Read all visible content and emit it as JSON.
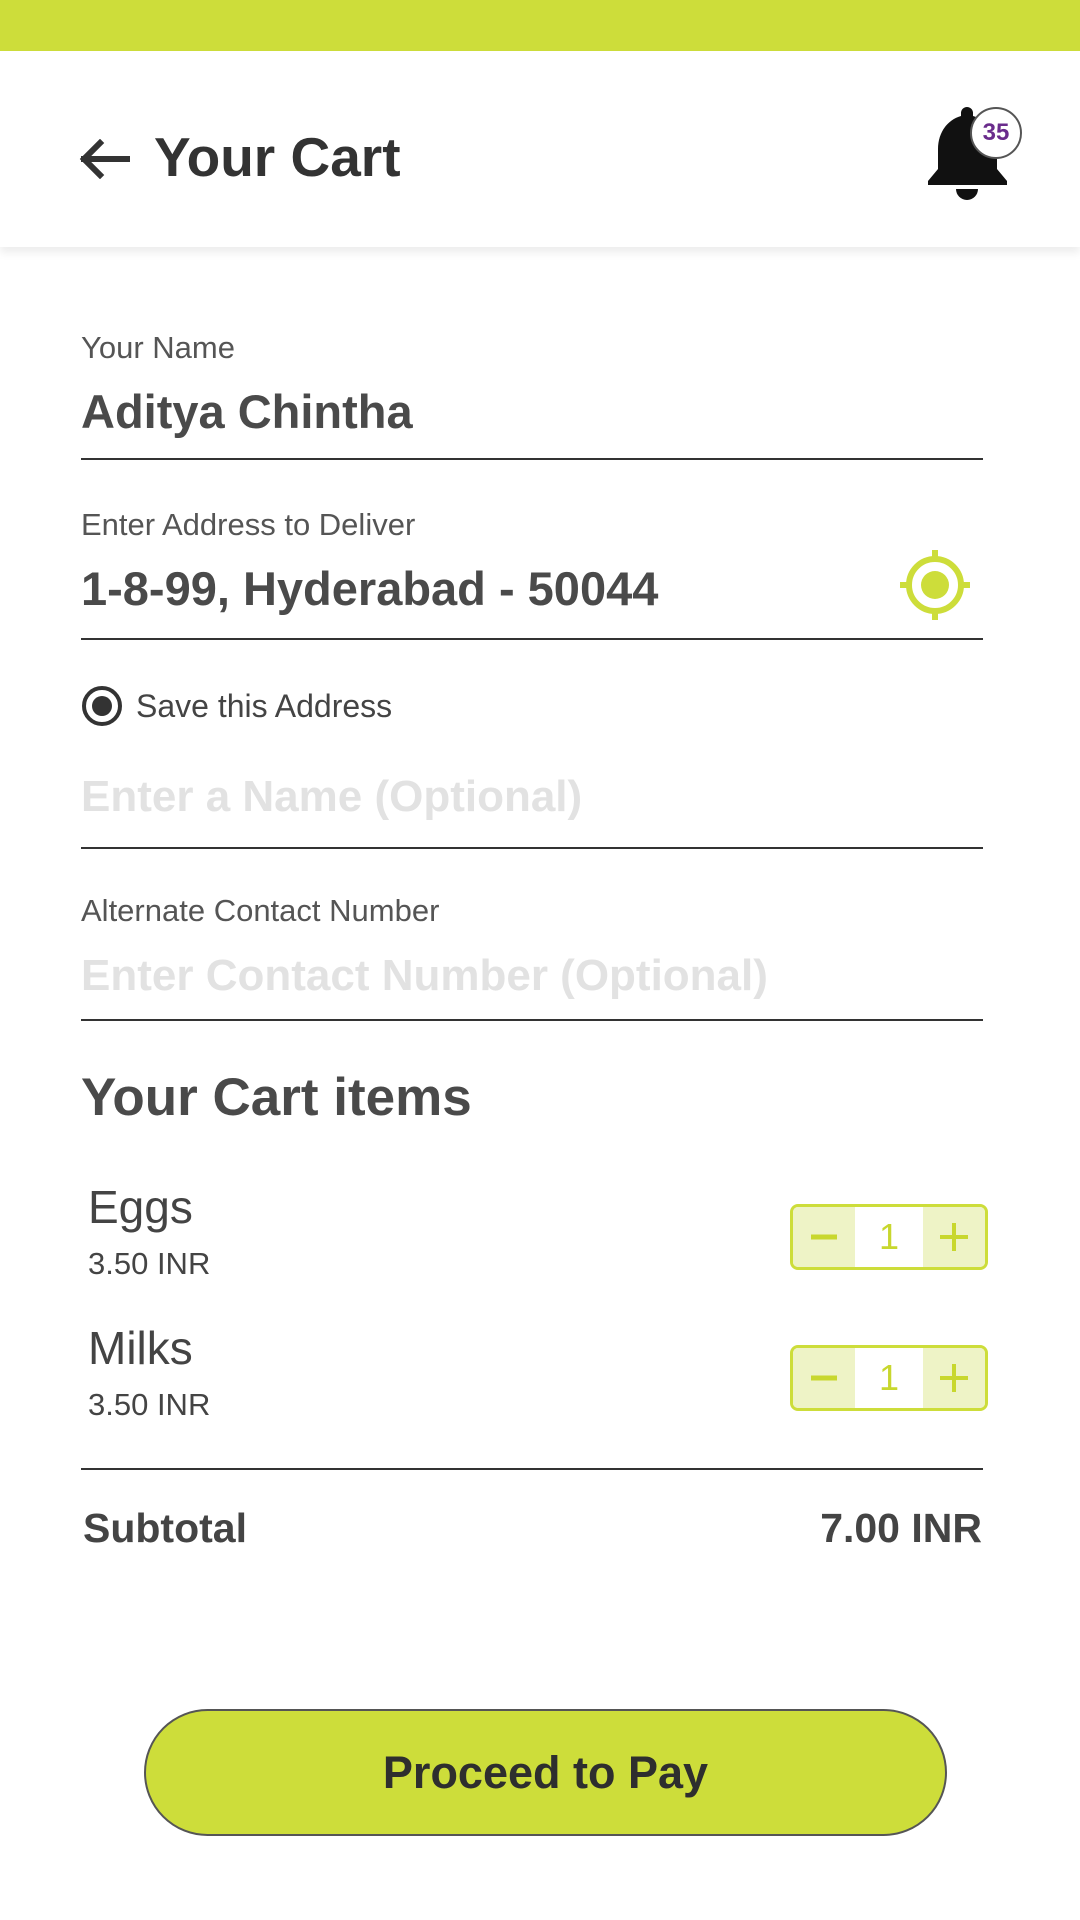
{
  "header": {
    "title": "Your Cart",
    "notification_count": "35"
  },
  "form": {
    "name_label": "Your Name",
    "name_value": "Aditya Chintha",
    "address_label": "Enter Address to Deliver",
    "address_value": "1-8-99, Hyderabad - 50044",
    "save_address_label": "Save this Address",
    "save_address_checked": true,
    "address_name_placeholder": "Enter a Name (Optional)",
    "alt_contact_label": "Alternate Contact Number",
    "alt_contact_placeholder": "Enter Contact Number (Optional)"
  },
  "cart": {
    "section_title": "Your Cart items",
    "items": [
      {
        "name": "Eggs",
        "price": "3.50 INR",
        "quantity": "1"
      },
      {
        "name": "Milks",
        "price": "3.50 INR",
        "quantity": "1"
      }
    ],
    "subtotal_label": "Subtotal",
    "subtotal_value": "7.00 INR"
  },
  "actions": {
    "pay_label": "Proceed to Pay"
  },
  "colors": {
    "accent": "#cddd3a",
    "badge_text": "#6a2c8c",
    "placeholder": "#e2e2e2"
  },
  "icons": {
    "back": "arrow-left-icon",
    "bell": "bell-icon",
    "locate": "crosshair-icon",
    "minus": "minus-icon",
    "plus": "plus-icon"
  }
}
